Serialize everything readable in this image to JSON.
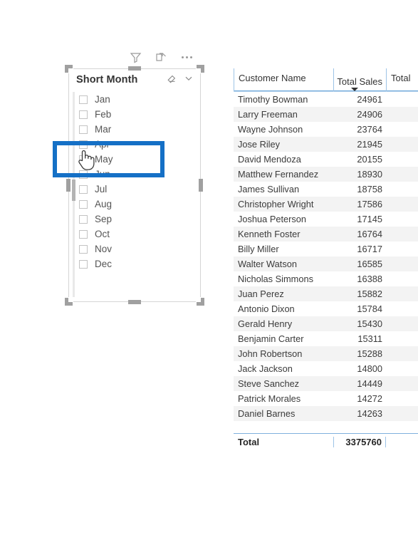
{
  "slicer": {
    "title": "Short Month",
    "header_icons": [
      {
        "name": "filter-icon",
        "glyph": "filter"
      },
      {
        "name": "focus-mode-icon",
        "glyph": "expand"
      },
      {
        "name": "more-options-icon",
        "glyph": "ellipsis"
      }
    ],
    "actions": [
      {
        "name": "clear-selections-icon",
        "glyph": "eraser"
      },
      {
        "name": "slicer-dropdown-icon",
        "glyph": "chevron-down"
      }
    ],
    "items": [
      {
        "label": "Jan",
        "checked": false
      },
      {
        "label": "Feb",
        "checked": false
      },
      {
        "label": "Mar",
        "checked": false
      },
      {
        "label": "Apr",
        "checked": false
      },
      {
        "label": "May",
        "checked": false
      },
      {
        "label": "Jun",
        "checked": false
      },
      {
        "label": "Jul",
        "checked": false
      },
      {
        "label": "Aug",
        "checked": false
      },
      {
        "label": "Sep",
        "checked": false
      },
      {
        "label": "Oct",
        "checked": false
      },
      {
        "label": "Nov",
        "checked": false
      },
      {
        "label": "Dec",
        "checked": false
      }
    ]
  },
  "highlight": {
    "color": "#1570c6",
    "target": "May"
  },
  "table": {
    "columns": [
      {
        "label": "Customer Name",
        "align": "left"
      },
      {
        "label": "Total Sales",
        "align": "right",
        "sorted": "desc"
      },
      {
        "label": "Total",
        "align": "right"
      }
    ],
    "rows": [
      {
        "name": "Timothy Bowman",
        "sales": "24961"
      },
      {
        "name": "Larry Freeman",
        "sales": "24906"
      },
      {
        "name": "Wayne Johnson",
        "sales": "23764"
      },
      {
        "name": "Jose Riley",
        "sales": "21945"
      },
      {
        "name": "David Mendoza",
        "sales": "20155"
      },
      {
        "name": "Matthew Fernandez",
        "sales": "18930"
      },
      {
        "name": "James Sullivan",
        "sales": "18758"
      },
      {
        "name": "Christopher Wright",
        "sales": "17586"
      },
      {
        "name": "Joshua Peterson",
        "sales": "17145"
      },
      {
        "name": "Kenneth Foster",
        "sales": "16764"
      },
      {
        "name": "Billy Miller",
        "sales": "16717"
      },
      {
        "name": "Walter Watson",
        "sales": "16585"
      },
      {
        "name": "Nicholas Simmons",
        "sales": "16388"
      },
      {
        "name": "Juan Perez",
        "sales": "15882"
      },
      {
        "name": "Antonio Dixon",
        "sales": "15784"
      },
      {
        "name": "Gerald Henry",
        "sales": "15430"
      },
      {
        "name": "Benjamin Carter",
        "sales": "15311"
      },
      {
        "name": "John Robertson",
        "sales": "15288"
      },
      {
        "name": "Jack Jackson",
        "sales": "14800"
      },
      {
        "name": "Steve Sanchez",
        "sales": "14449"
      },
      {
        "name": "Patrick Morales",
        "sales": "14272"
      },
      {
        "name": "Daniel Barnes",
        "sales": "14263"
      }
    ],
    "total": {
      "label": "Total",
      "sales": "3375760"
    }
  }
}
